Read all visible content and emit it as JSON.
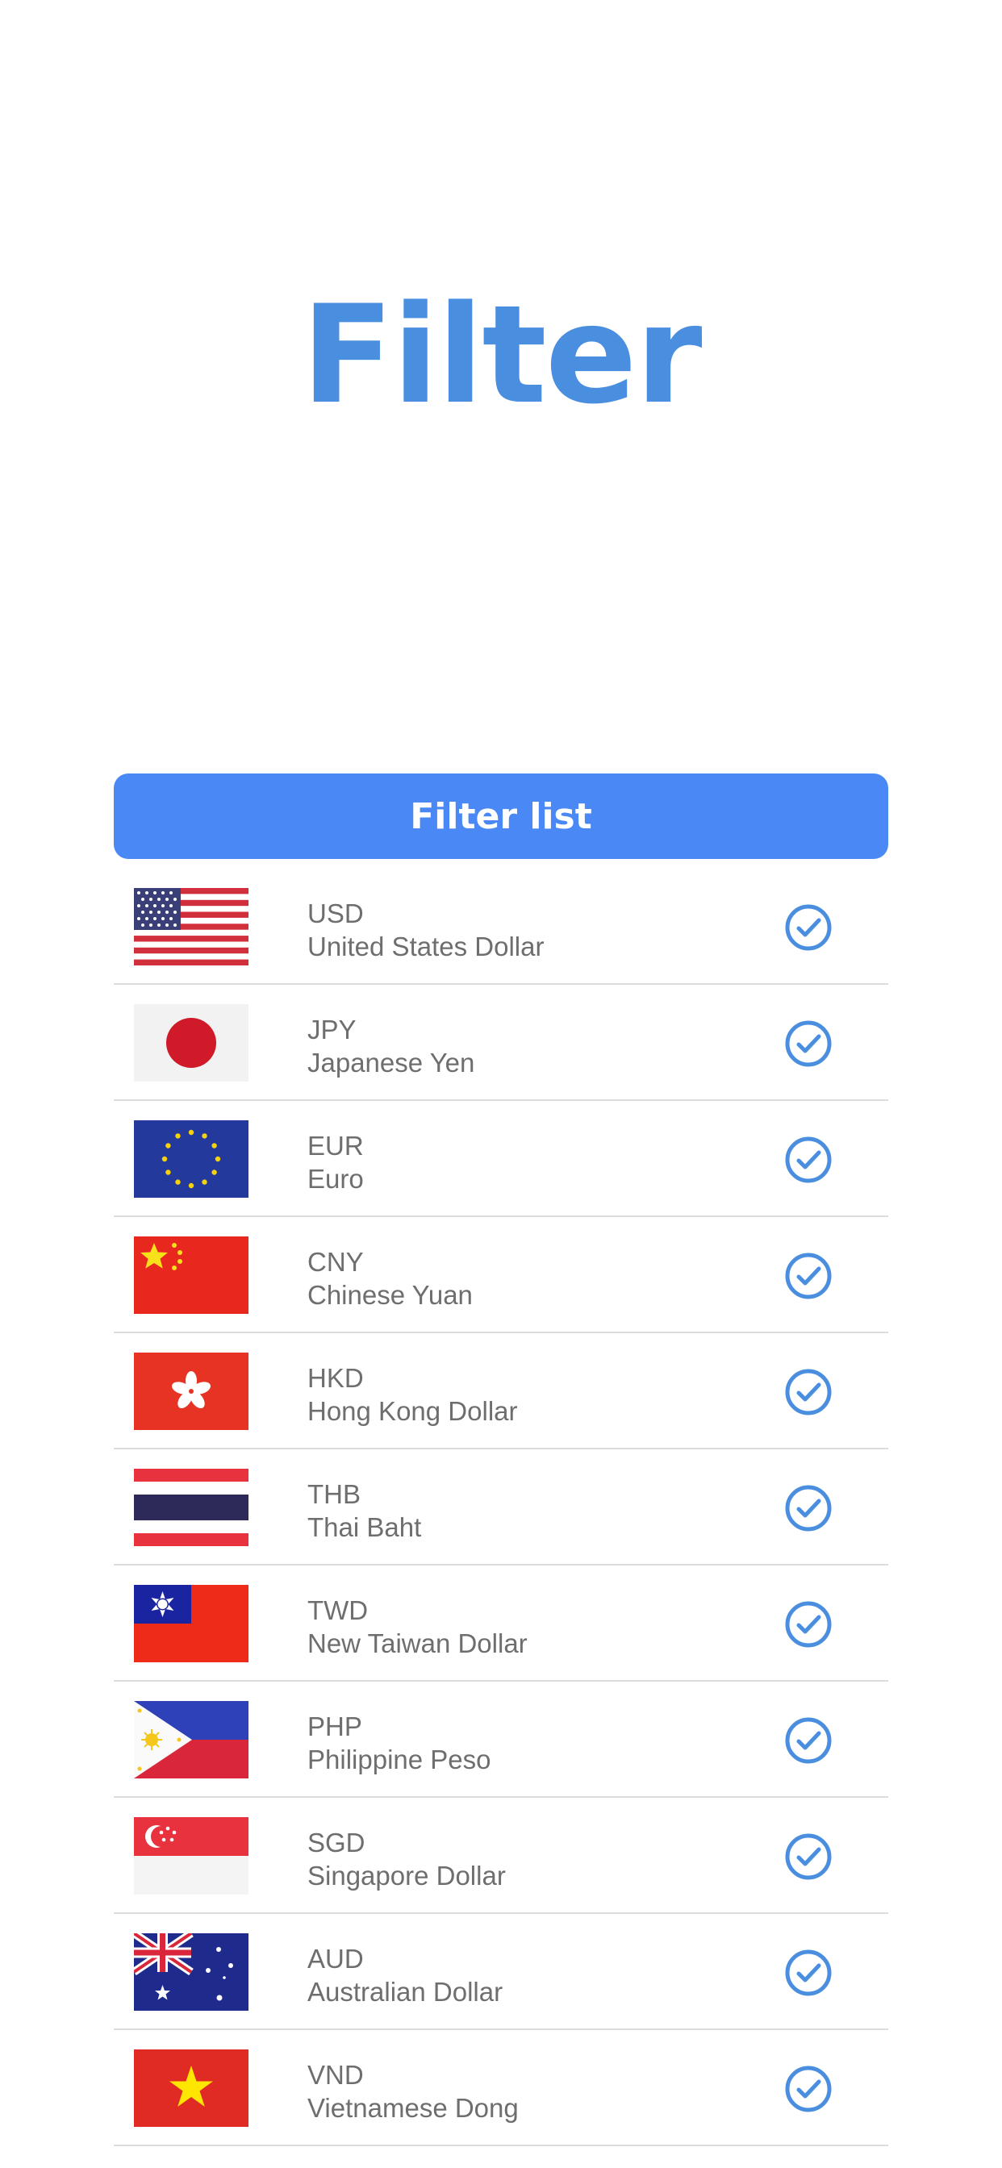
{
  "title": "Filter",
  "filter_button_label": "Filter list",
  "colors": {
    "title": "#4a8ee0",
    "button": "#4a89f5",
    "check": "#4a8ee0"
  },
  "currencies": [
    {
      "code": "USD",
      "name": "United States Dollar",
      "flag_icon": "us-flag-icon",
      "checked": true
    },
    {
      "code": "JPY",
      "name": "Japanese Yen",
      "flag_icon": "jp-flag-icon",
      "checked": true
    },
    {
      "code": "EUR",
      "name": "Euro",
      "flag_icon": "eu-flag-icon",
      "checked": true
    },
    {
      "code": "CNY",
      "name": "Chinese Yuan",
      "flag_icon": "cn-flag-icon",
      "checked": true
    },
    {
      "code": "HKD",
      "name": "Hong Kong Dollar",
      "flag_icon": "hk-flag-icon",
      "checked": true
    },
    {
      "code": "THB",
      "name": "Thai Baht",
      "flag_icon": "th-flag-icon",
      "checked": true
    },
    {
      "code": "TWD",
      "name": "New Taiwan Dollar",
      "flag_icon": "tw-flag-icon",
      "checked": true
    },
    {
      "code": "PHP",
      "name": "Philippine Peso",
      "flag_icon": "ph-flag-icon",
      "checked": true
    },
    {
      "code": "SGD",
      "name": "Singapore Dollar",
      "flag_icon": "sg-flag-icon",
      "checked": true
    },
    {
      "code": "AUD",
      "name": "Australian Dollar",
      "flag_icon": "au-flag-icon",
      "checked": true
    },
    {
      "code": "VND",
      "name": "Vietnamese Dong",
      "flag_icon": "vn-flag-icon",
      "checked": true
    }
  ]
}
